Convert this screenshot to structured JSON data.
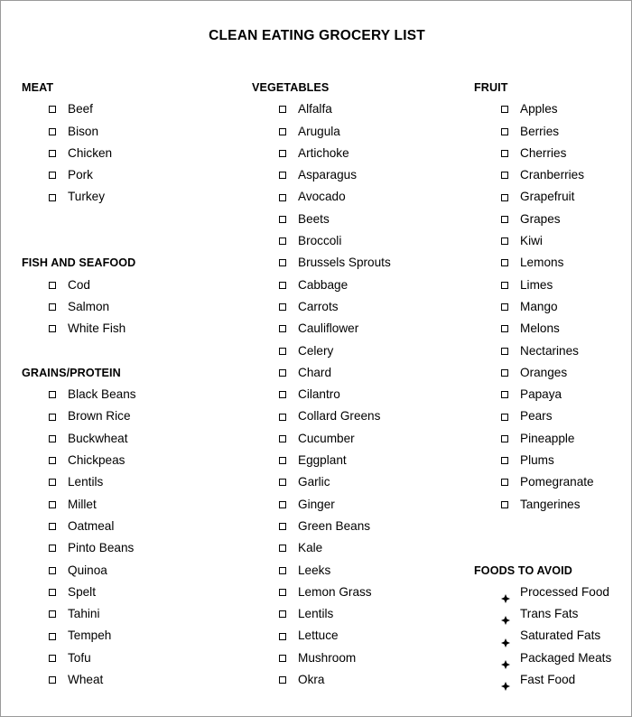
{
  "document": {
    "title": "CLEAN EATING GROCERY LIST"
  },
  "columns": [
    {
      "id": "column-left",
      "sections": [
        {
          "heading": "MEAT",
          "bullet": "checkbox",
          "gap_before": 0,
          "items": [
            "Beef",
            "Bison",
            "Chicken",
            "Pork",
            "Turkey"
          ]
        },
        {
          "heading": "FISH AND SEAFOOD",
          "bullet": "checkbox",
          "gap_before": 2,
          "items": [
            "Cod",
            "Salmon",
            "White Fish"
          ]
        },
        {
          "heading": "GRAINS/PROTEIN",
          "bullet": "checkbox",
          "gap_before": 1,
          "items": [
            "Black Beans",
            "Brown Rice",
            "Buckwheat",
            "Chickpeas",
            "Lentils",
            "Millet",
            "Oatmeal",
            "Pinto Beans",
            "Quinoa",
            "Spelt",
            "Tahini",
            "Tempeh",
            "Tofu",
            "Wheat"
          ]
        }
      ]
    },
    {
      "id": "column-middle",
      "sections": [
        {
          "heading": "VEGETABLES",
          "bullet": "checkbox",
          "gap_before": 0,
          "items": [
            "Alfalfa",
            "Arugula",
            "Artichoke",
            "Asparagus",
            "Avocado",
            "Beets",
            "Broccoli",
            "Brussels Sprouts",
            "Cabbage",
            "Carrots",
            "Cauliflower",
            "Celery",
            "Chard",
            "Cilantro",
            "Collard Greens",
            "Cucumber",
            "Eggplant",
            "Garlic",
            "Ginger",
            "Green Beans",
            "Kale",
            "Leeks",
            "Lemon Grass",
            "Lentils",
            "Lettuce",
            "Mushroom",
            "Okra"
          ]
        }
      ]
    },
    {
      "id": "column-right",
      "sections": [
        {
          "heading": "FRUIT",
          "bullet": "checkbox",
          "gap_before": 0,
          "items": [
            "Apples",
            "Berries",
            "Cherries",
            "Cranberries",
            "Grapefruit",
            "Grapes",
            "Kiwi",
            "Lemons",
            "Limes",
            "Mango",
            "Melons",
            "Nectarines",
            "Oranges",
            "Papaya",
            "Pears",
            "Pineapple",
            "Plums",
            "Pomegranate",
            "Tangerines"
          ]
        },
        {
          "heading": "FOODS TO AVOID",
          "bullet": "floret",
          "gap_before": 2,
          "items": [
            "Processed Food",
            "Trans Fats",
            "Saturated Fats",
            "Packaged Meats",
            "Fast Food"
          ]
        }
      ]
    }
  ],
  "colors": {
    "page_background": "#ffffff",
    "text": "#000000",
    "page_border": "#9a9a9a"
  }
}
